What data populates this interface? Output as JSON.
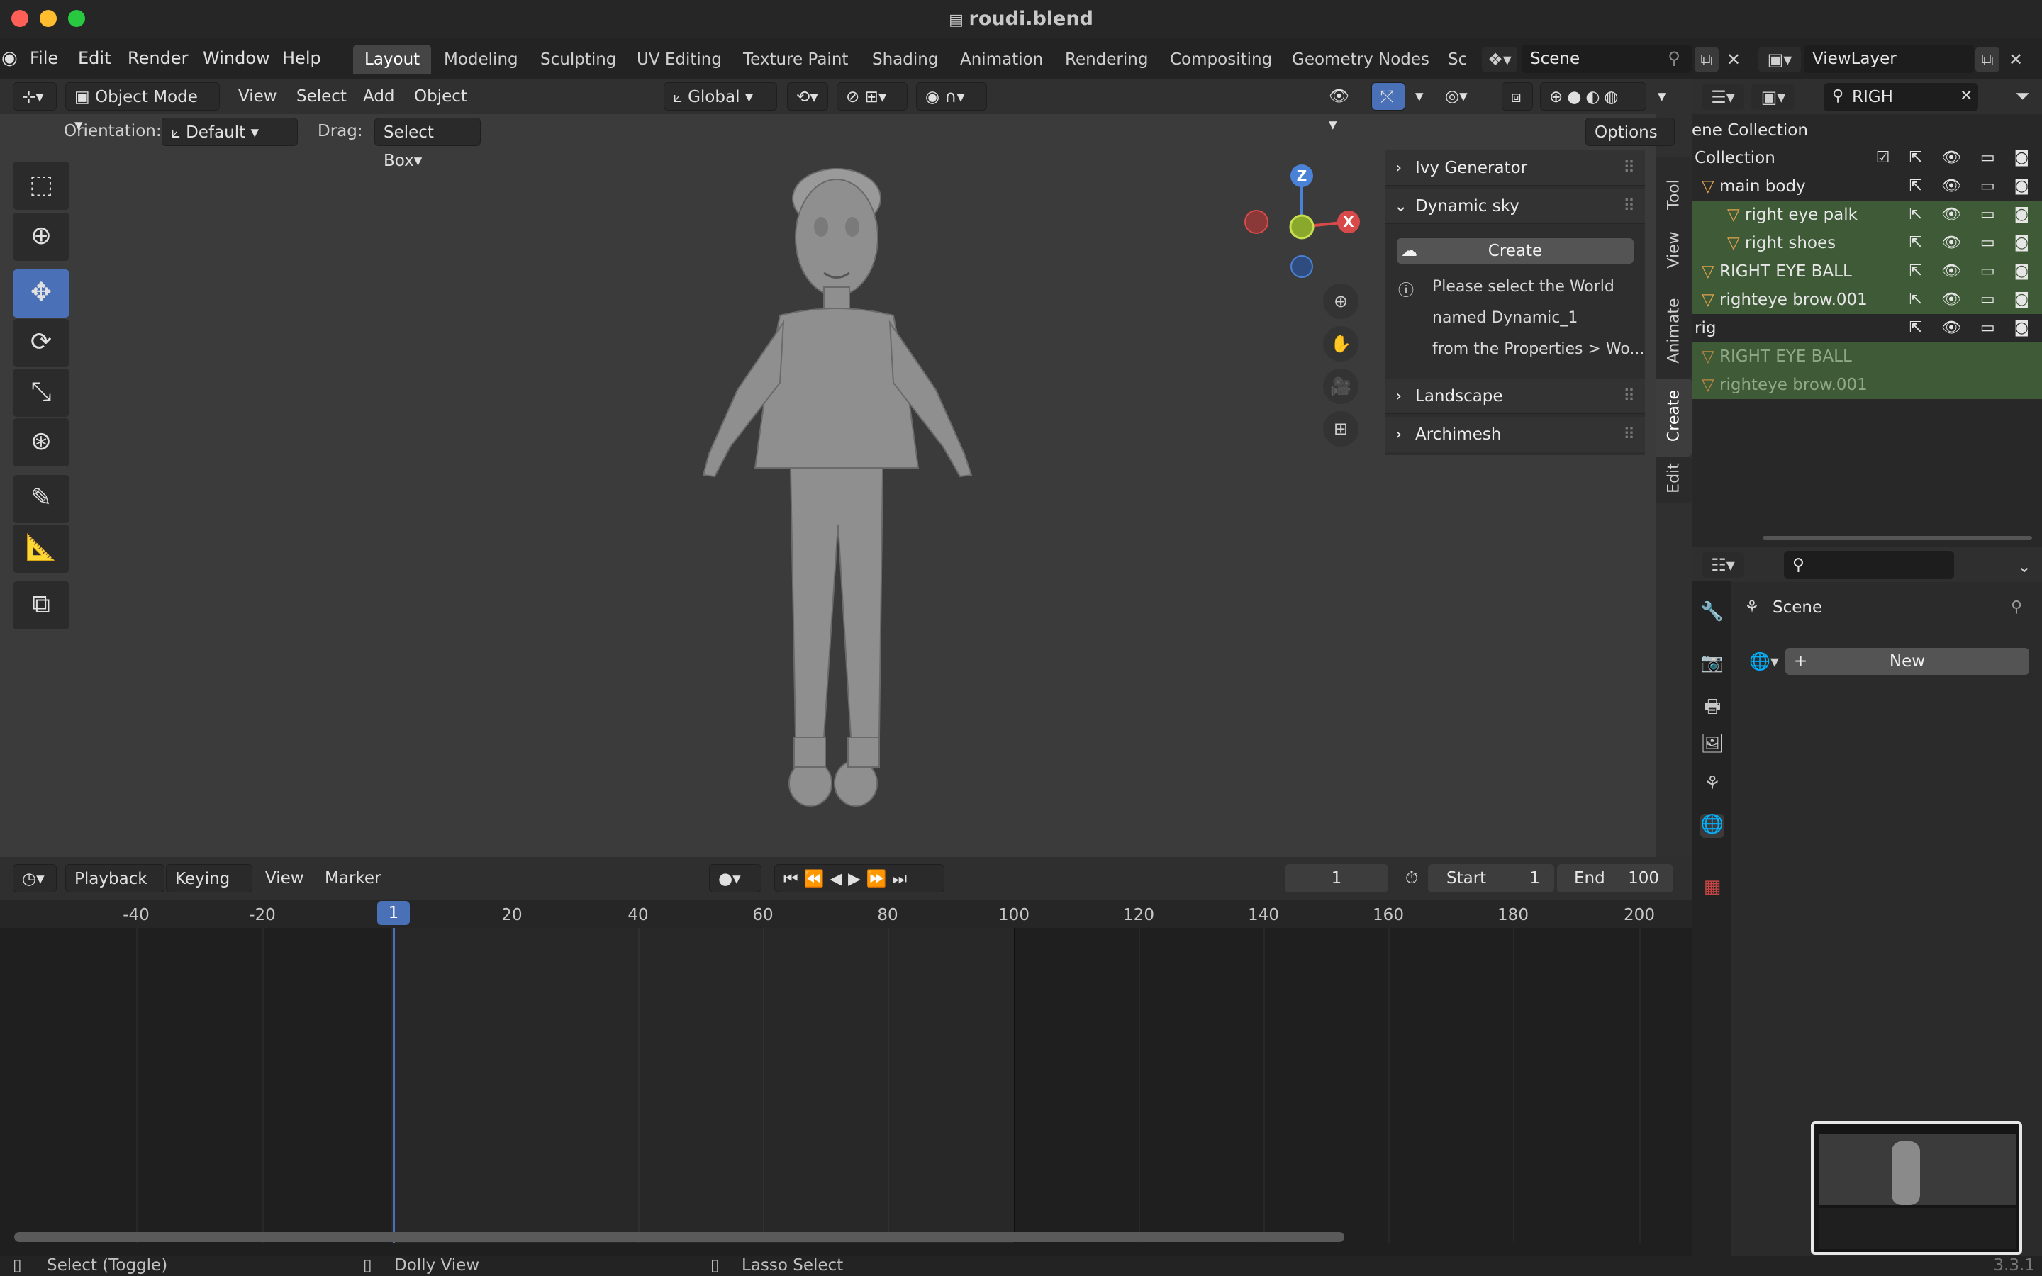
{
  "window": {
    "title": "roudi.blend",
    "version": "3.3.1"
  },
  "menubar": {
    "items": [
      "File",
      "Edit",
      "Render",
      "Window",
      "Help"
    ]
  },
  "workspaces": {
    "active": "Layout",
    "tabs": [
      "Layout",
      "Modeling",
      "Sculpting",
      "UV Editing",
      "Texture Paint",
      "Shading",
      "Animation",
      "Rendering",
      "Compositing",
      "Geometry Nodes",
      "Sc"
    ]
  },
  "scene_selector": {
    "label": "Scene"
  },
  "view_layer": {
    "label": "ViewLayer"
  },
  "viewport_header": {
    "mode": "Object Mode",
    "menus": [
      "View",
      "Select",
      "Add",
      "Object"
    ],
    "transform_orientation": "Global",
    "orientation_label": "Orientation:",
    "orientation_value": "Default",
    "drag_label": "Drag:",
    "drag_value": "Select Box",
    "options_label": "Options"
  },
  "gizmo": {
    "z": "Z",
    "x": "X"
  },
  "npanel": {
    "tabs": [
      "Tool",
      "View",
      "Animate",
      "Create",
      "Edit"
    ],
    "active_tab": "Create",
    "sections": [
      {
        "label": "Ivy Generator",
        "expanded": false
      },
      {
        "label": "Dynamic sky",
        "expanded": true
      },
      {
        "label": "Landscape",
        "expanded": false
      },
      {
        "label": "Archimesh",
        "expanded": false
      }
    ],
    "create_button": "Create",
    "info_lines": [
      "Please select the World",
      "named Dynamic_1",
      "from the Properties > Wo..."
    ]
  },
  "outliner": {
    "search_value": "RIGH",
    "header": "ene Collection",
    "rows": [
      {
        "label": "Collection",
        "type": "collection",
        "selected": false
      },
      {
        "label": "main body",
        "type": "mesh",
        "selected": false
      },
      {
        "label": "right eye palk",
        "type": "mesh",
        "selected": true
      },
      {
        "label": "right shoes",
        "type": "mesh",
        "selected": true
      },
      {
        "label": "RIGHT EYE BALL",
        "type": "mesh",
        "selected": true
      },
      {
        "label": "righteye brow.001",
        "type": "mesh",
        "selected": true
      },
      {
        "label": "rig",
        "type": "armature",
        "selected": false
      },
      {
        "label": "RIGHT EYE BALL",
        "type": "mesh",
        "selected": true
      },
      {
        "label": "righteye brow.001",
        "type": "mesh",
        "selected": true
      }
    ]
  },
  "properties": {
    "scene_label": "Scene",
    "new_button": "New"
  },
  "timeline": {
    "menus": [
      "Playback",
      "Keying",
      "View",
      "Marker"
    ],
    "current_frame": "1",
    "start_label": "Start",
    "start_value": "1",
    "end_label": "End",
    "end_value": "100",
    "ruler_ticks": [
      "-40",
      "-20",
      "1",
      "20",
      "40",
      "60",
      "80",
      "100",
      "120",
      "140",
      "160",
      "180",
      "200"
    ],
    "playhead_label": "1"
  },
  "statusbar": {
    "items": [
      "Select (Toggle)",
      "Dolly View",
      "Lasso Select"
    ]
  },
  "colors": {
    "accent": "#4a70b8",
    "selection": "#3e5a36",
    "mesh_icon": "#e4a34c"
  }
}
